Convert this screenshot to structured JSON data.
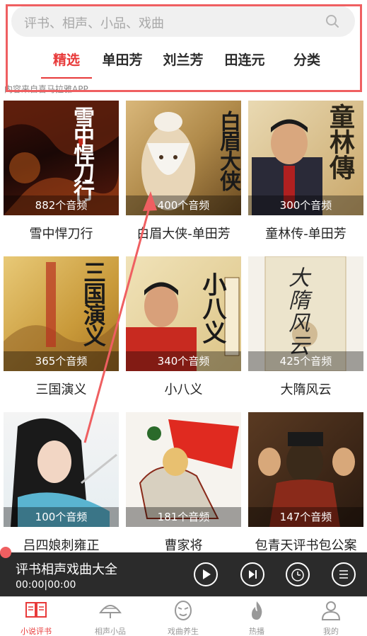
{
  "search": {
    "placeholder": "评书、相声、小品、戏曲"
  },
  "tabs": [
    {
      "label": "精选",
      "active": true
    },
    {
      "label": "单田芳",
      "active": false
    },
    {
      "label": "刘兰芳",
      "active": false
    },
    {
      "label": "田连元",
      "active": false
    },
    {
      "label": "分类",
      "active": false
    }
  ],
  "source_note": "内容来自喜马拉雅APP",
  "cards": [
    {
      "title": "雪中悍刀行",
      "count": "882个音频",
      "cover_text": "雪中悍刀行"
    },
    {
      "title": "白眉大侠-单田芳",
      "count": "400个音频",
      "cover_text": "白眉大侠"
    },
    {
      "title": "童林传-单田芳",
      "count": "300个音频",
      "cover_text": "童林傳"
    },
    {
      "title": "三国演义",
      "count": "365个音频",
      "cover_text": "三国演义"
    },
    {
      "title": "小八义",
      "count": "340个音频",
      "cover_text": "小八义"
    },
    {
      "title": "大隋风云",
      "count": "425个音频",
      "cover_text": "大隋风云"
    },
    {
      "title": "吕四娘刺雍正",
      "count": "100个音频",
      "cover_text": ""
    },
    {
      "title": "曹家将",
      "count": "181个音频",
      "cover_text": ""
    },
    {
      "title": "包青天评书包公案",
      "count": "147个音频",
      "cover_text": ""
    }
  ],
  "player": {
    "title": "评书相声戏曲大全",
    "time": "00:00|00:00"
  },
  "nav": [
    {
      "label": "小说评书",
      "icon": "book-icon",
      "active": true
    },
    {
      "label": "相声小品",
      "icon": "fan-icon",
      "active": false
    },
    {
      "label": "戏曲养生",
      "icon": "opera-mask-icon",
      "active": false
    },
    {
      "label": "热播",
      "icon": "flame-icon",
      "active": false
    },
    {
      "label": "我的",
      "icon": "user-icon",
      "active": false
    }
  ],
  "colors": {
    "accent": "#e83a3a",
    "player_bg": "#2b2b2b",
    "annotation": "#ef5f61"
  }
}
